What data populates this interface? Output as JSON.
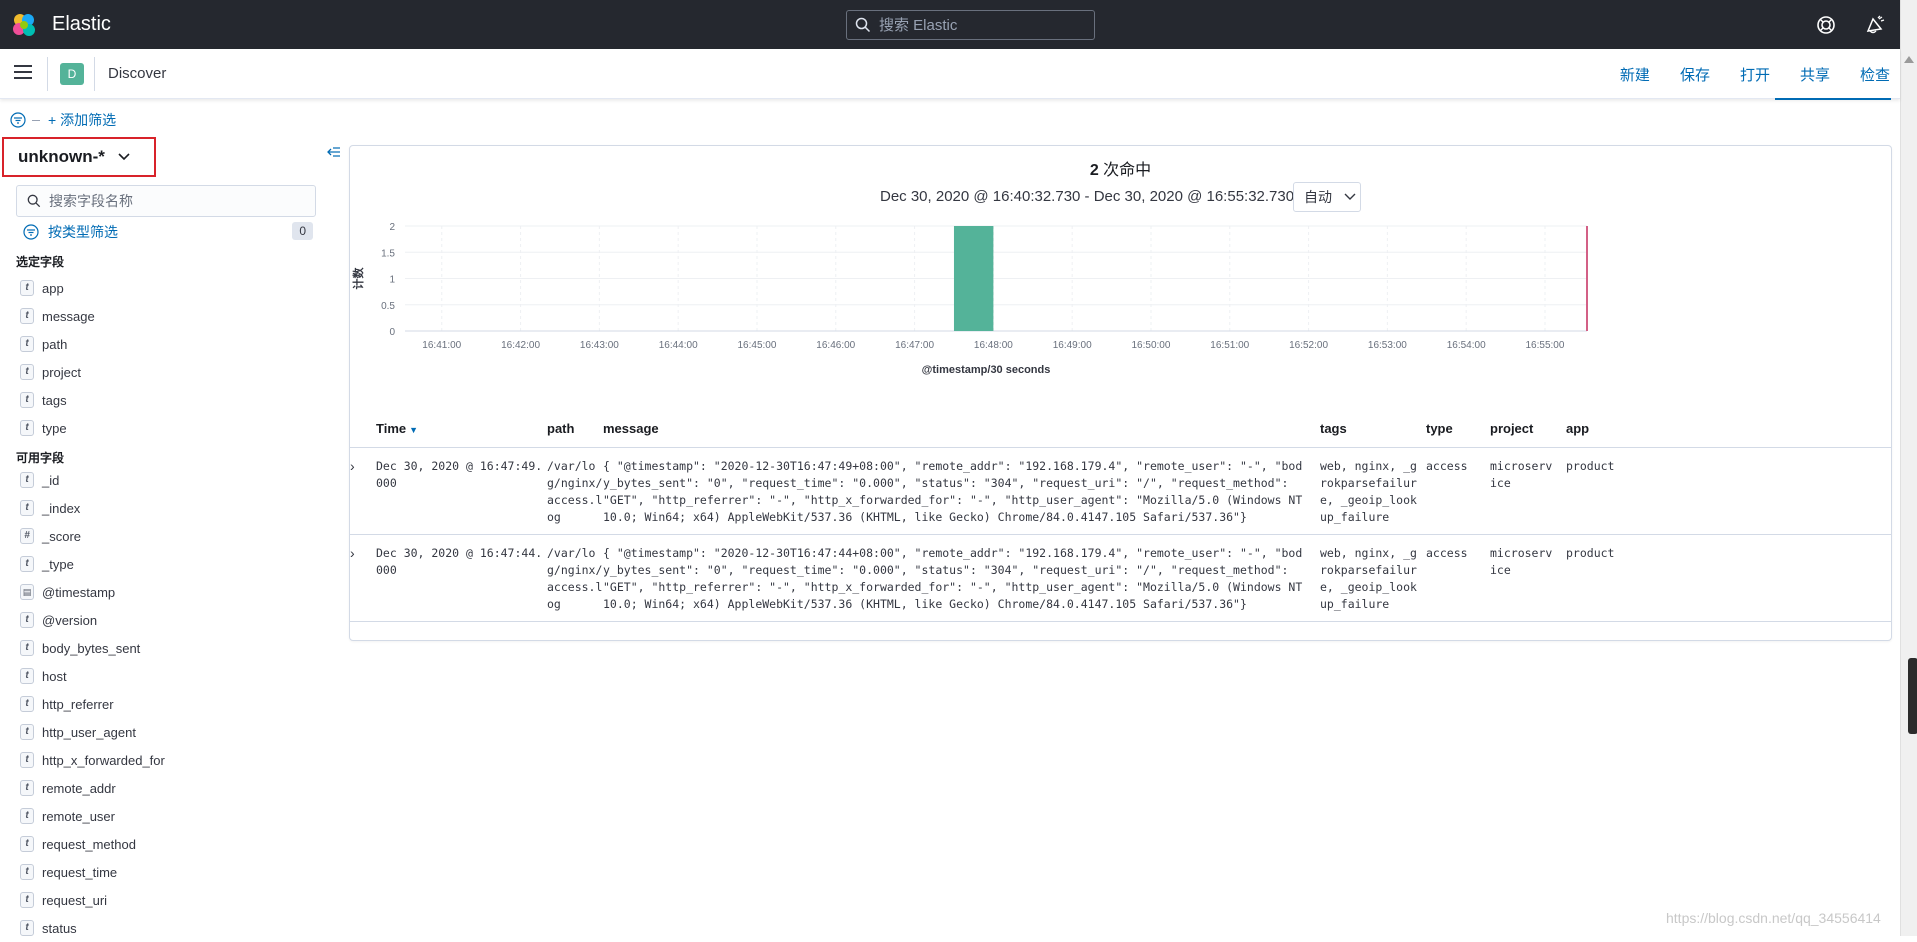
{
  "header": {
    "brand": "Elastic",
    "search_placeholder": "搜索 Elastic"
  },
  "navbar": {
    "app_badge": "D",
    "page_title": "Discover",
    "actions": [
      "新建",
      "保存",
      "打开",
      "共享",
      "检查"
    ]
  },
  "filter_bar": {
    "add_filter": "+ 添加筛选"
  },
  "sidebar": {
    "index_pattern": "unknown-*",
    "field_search_placeholder": "搜索字段名称",
    "type_filter_label": "按类型筛选",
    "type_filter_count": "0",
    "selected_title": "选定字段",
    "selected_fields": [
      {
        "type": "t",
        "name": "app"
      },
      {
        "type": "t",
        "name": "message"
      },
      {
        "type": "t",
        "name": "path"
      },
      {
        "type": "t",
        "name": "project"
      },
      {
        "type": "t",
        "name": "tags"
      },
      {
        "type": "t",
        "name": "type"
      }
    ],
    "available_title": "可用字段",
    "available_fields": [
      {
        "type": "t",
        "name": "_id"
      },
      {
        "type": "t",
        "name": "_index"
      },
      {
        "type": "#",
        "name": "_score"
      },
      {
        "type": "t",
        "name": "_type"
      },
      {
        "type": "date",
        "name": "@timestamp"
      },
      {
        "type": "t",
        "name": "@version"
      },
      {
        "type": "t",
        "name": "body_bytes_sent"
      },
      {
        "type": "t",
        "name": "host"
      },
      {
        "type": "t",
        "name": "http_referrer"
      },
      {
        "type": "t",
        "name": "http_user_agent"
      },
      {
        "type": "t",
        "name": "http_x_forwarded_for"
      },
      {
        "type": "t",
        "name": "remote_addr"
      },
      {
        "type": "t",
        "name": "remote_user"
      },
      {
        "type": "t",
        "name": "request_method"
      },
      {
        "type": "t",
        "name": "request_time"
      },
      {
        "type": "t",
        "name": "request_uri"
      },
      {
        "type": "t",
        "name": "status"
      }
    ]
  },
  "main": {
    "hits_count": "2",
    "hits_label": " 次命中",
    "time_range": "Dec 30, 2020 @ 16:40:32.730 - Dec 30, 2020 @ 16:55:32.730",
    "interval": "自动"
  },
  "chart_data": {
    "type": "bar",
    "xlabel": "@timestamp/30 seconds",
    "ylabel": "计数",
    "ylim": [
      0,
      2
    ],
    "y_ticks": [
      "0",
      "0.5",
      "1",
      "1.5",
      "2"
    ],
    "x_ticks": [
      "16:41:00",
      "16:42:00",
      "16:43:00",
      "16:44:00",
      "16:45:00",
      "16:46:00",
      "16:47:00",
      "16:48:00",
      "16:49:00",
      "16:50:00",
      "16:51:00",
      "16:52:00",
      "16:53:00",
      "16:54:00",
      "16:55:00"
    ],
    "x_range": [
      "16:40:32",
      "16:55:32"
    ],
    "bars": [
      {
        "start": "16:47:30",
        "end": "16:48:00",
        "value": 2
      }
    ],
    "now_marker": "16:55:32",
    "bar_color": "#54b399",
    "marker_color": "#d36086"
  },
  "table": {
    "columns": [
      "Time",
      "path",
      "message",
      "tags",
      "type",
      "project",
      "app"
    ],
    "rows": [
      {
        "time": "Dec 30, 2020 @ 16:47:49.000",
        "path": "/var/log/nginx/access.log",
        "message": "{ \"@timestamp\": \"2020-12-30T16:47:49+08:00\", \"remote_addr\": \"192.168.179.4\", \"remote_user\": \"-\", \"body_bytes_sent\": \"0\", \"request_time\": \"0.000\", \"status\": \"304\", \"request_uri\": \"/\", \"request_method\": \"GET\", \"http_referrer\": \"-\", \"http_x_forwarded_for\": \"-\", \"http_user_agent\": \"Mozilla/5.0 (Windows NT 10.0; Win64; x64) AppleWebKit/537.36 (KHTML, like Gecko) Chrome/84.0.4147.105 Safari/537.36\"}",
        "tags": "web, nginx, _grokparsefailure, _geoip_lookup_failure",
        "type": "access",
        "project": "microservice",
        "app": "product"
      },
      {
        "time": "Dec 30, 2020 @ 16:47:44.000",
        "path": "/var/log/nginx/access.log",
        "message": "{ \"@timestamp\": \"2020-12-30T16:47:44+08:00\", \"remote_addr\": \"192.168.179.4\", \"remote_user\": \"-\", \"body_bytes_sent\": \"0\", \"request_time\": \"0.000\", \"status\": \"304\", \"request_uri\": \"/\", \"request_method\": \"GET\", \"http_referrer\": \"-\", \"http_x_forwarded_for\": \"-\", \"http_user_agent\": \"Mozilla/5.0 (Windows NT 10.0; Win64; x64) AppleWebKit/537.36 (KHTML, like Gecko) Chrome/84.0.4147.105 Safari/537.36\"}",
        "tags": "web, nginx, _grokparsefailure, _geoip_lookup_failure",
        "type": "access",
        "project": "microservice",
        "app": "product"
      }
    ]
  },
  "watermark": "https://blog.csdn.net/qq_34556414",
  "colors": {
    "header_bg": "#25282f",
    "link": "#006bb4",
    "highlight_border": "#d8232a"
  }
}
